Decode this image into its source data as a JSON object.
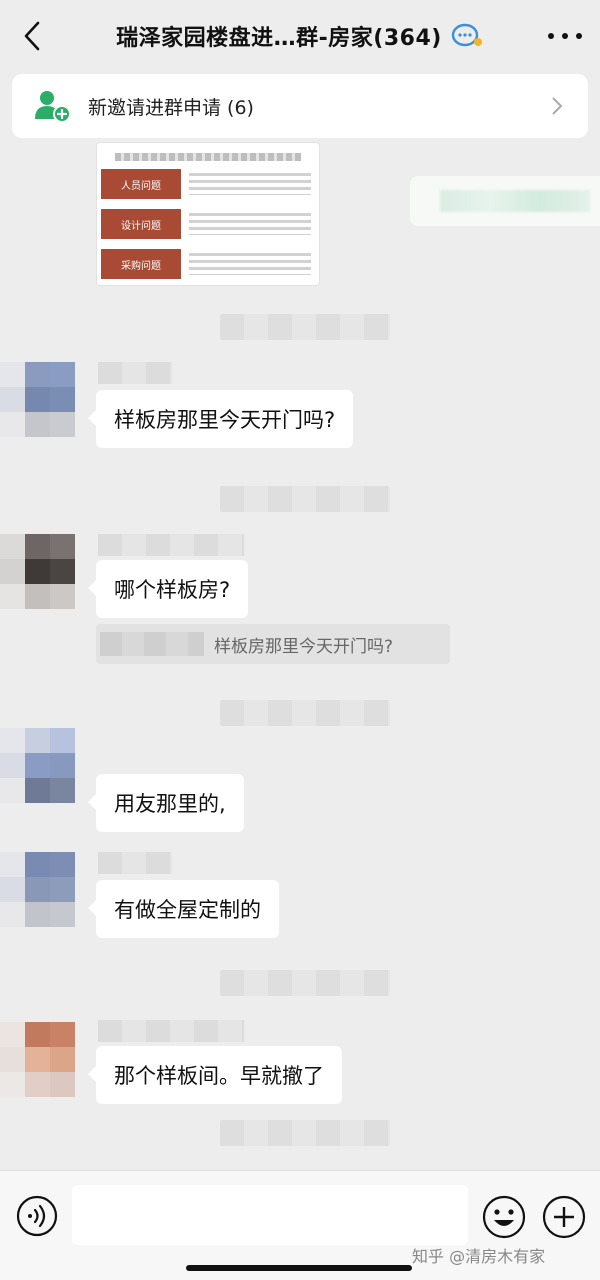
{
  "header": {
    "title": "瑞泽家园楼盘进…群-房家(364)",
    "back_icon": "chevron-left-icon",
    "more_icon": "more-dots-icon",
    "title_icon": "chat-bubbles-icon"
  },
  "banner": {
    "text": "新邀请进群申请 (6)",
    "icon": "add-user-icon",
    "chevron_icon": "chevron-right-icon"
  },
  "image_message": {
    "rows": [
      {
        "label": "人员问题"
      },
      {
        "label": "设计问题"
      },
      {
        "label": "采购问题"
      }
    ]
  },
  "messages": [
    {
      "text": "样板房那里今天开门吗?"
    },
    {
      "text": "哪个样板房?"
    },
    {
      "text": "用友那里的,"
    },
    {
      "text": "有做全屋定制的"
    },
    {
      "text": "那个样板间。早就撤了"
    }
  ],
  "quote": {
    "text": "样板房那里今天开门吗?"
  },
  "composer": {
    "voice_icon": "voice-icon",
    "emoji_icon": "emoji-icon",
    "plus_icon": "plus-icon",
    "input_value": ""
  },
  "watermark": "知乎 @清房木有家",
  "colors": {
    "background": "#ededed",
    "bubble": "#ffffff",
    "accent_green": "#2aae67",
    "image_red": "#a84a34"
  }
}
